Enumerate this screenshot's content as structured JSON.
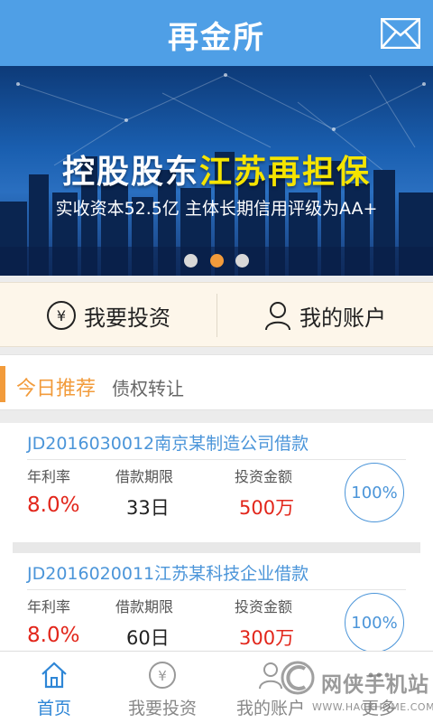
{
  "header": {
    "title": "再金所",
    "mail_icon": "mail-icon"
  },
  "banner": {
    "headline_white": "控股股东",
    "headline_yellow": "江苏再担保",
    "subline": "实收资本52.5亿 主体长期信用评级为AA+",
    "active_dot": 1,
    "colors": {
      "highlight": "#f5e400",
      "active_dot": "#f29b3b"
    }
  },
  "quicknav": {
    "items": [
      {
        "label": "我要投资",
        "icon": "yen-circle-icon"
      },
      {
        "label": "我的账户",
        "icon": "user-icon"
      }
    ]
  },
  "tabs": {
    "active": "今日推荐",
    "other": "债权转让"
  },
  "loans": {
    "labels": {
      "rate": "年利率",
      "period": "借款期限",
      "amount": "投资金额"
    },
    "items": [
      {
        "title": "JD2016030012南京某制造公司借款",
        "rate": "8.0%",
        "period": "33日",
        "amount": "500万",
        "progress": "100%"
      },
      {
        "title": "JD2016020011江苏某科技企业借款",
        "rate": "8.0%",
        "period": "60日",
        "amount": "300万",
        "progress": "100%"
      }
    ]
  },
  "bottomnav": {
    "items": [
      {
        "label": "首页",
        "icon": "home-icon",
        "active": true
      },
      {
        "label": "我要投资",
        "icon": "yen-circle-icon",
        "active": false
      },
      {
        "label": "我的账户",
        "icon": "user-icon",
        "active": false
      },
      {
        "label": "更多",
        "icon": "more-icon",
        "active": false
      }
    ]
  },
  "watermark": {
    "text": "网侠手机站",
    "url": "WWW.HACKHOME.COM"
  },
  "colors": {
    "primary": "#4f9fe6",
    "accent": "#f29b3b",
    "rate_red": "#e2261b",
    "link_blue": "#4b95d9"
  }
}
